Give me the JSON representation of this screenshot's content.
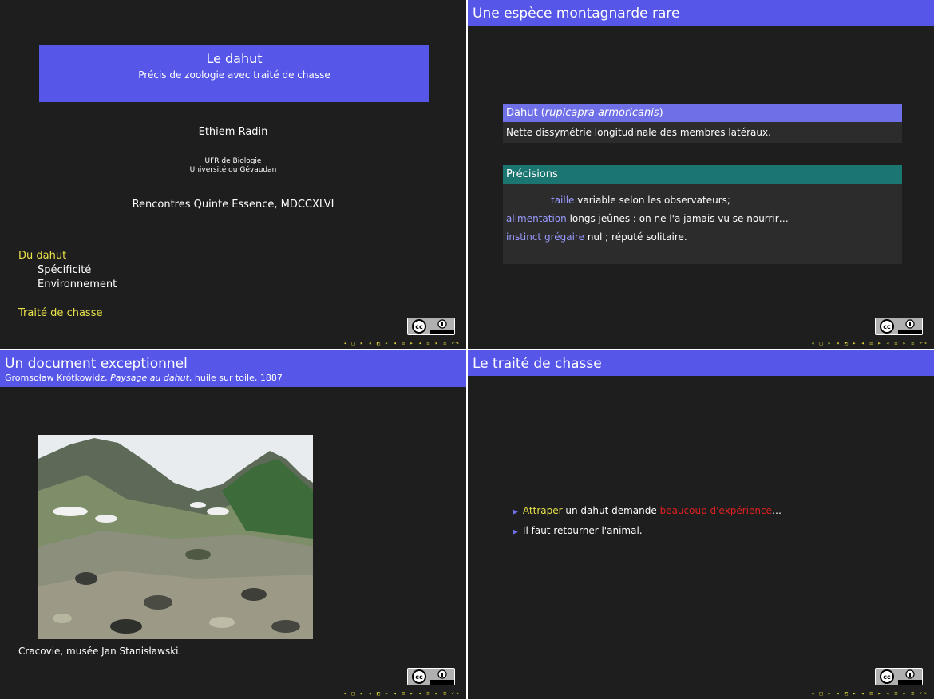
{
  "slide1": {
    "title": "Le dahut",
    "subtitle": "Précis de zoologie avec traité de chasse",
    "author": "Ethiem Radin",
    "institute_line1": "UFR de Biologie",
    "institute_line2": "Université du Gévaudan",
    "date": "Rencontres Quinte Essence, MDCCXLVI",
    "toc": [
      {
        "label": "Du dahut",
        "subs": [
          "Spécificité",
          "Environnement"
        ]
      },
      {
        "label": "Traité de chasse",
        "subs": []
      }
    ]
  },
  "slide2": {
    "title": "Une espèce montagnarde rare",
    "block1_title_prefix": "Dahut (",
    "block1_title_italic": "rupicapra armoricanis",
    "block1_title_suffix": ")",
    "block1_body": "Nette dissymétrie longitudinale des membres latéraux.",
    "block2_title": "Précisions",
    "definitions": [
      {
        "term": "taille",
        "desc": "variable selon les observateurs;"
      },
      {
        "term": "alimentation",
        "desc": "longs jeûnes : on ne l'a jamais vu se nourrir…"
      },
      {
        "term": "instinct grégaire",
        "desc": "nul ; réputé solitaire."
      }
    ]
  },
  "slide3": {
    "title": "Un document exceptionnel",
    "subtitle_prefix": "Gromsoław Krótkowidz, ",
    "subtitle_italic": "Paysage au dahut",
    "subtitle_suffix": ", huile sur toile, 1887",
    "caption": "Cracovie, musée Jan Stanisławski."
  },
  "slide4": {
    "title": "Le traité de chasse",
    "item1": {
      "yellow": "Attraper",
      "middle": " un dahut demande ",
      "red": "beaucoup d'expérience",
      "end": "…"
    },
    "item2": "Il faut retourner l'animal."
  },
  "common": {
    "nav_symbols": "◂ □ ▸ ◂ ◩ ▸ ◂ ≡ ▸ ◂ ≡ ▸   ≡   ↶↷",
    "license_badge_text": "cc BY"
  },
  "colors": {
    "background": "#1e1e1e",
    "accent": "#5656e9",
    "block_title": "#6f6fe7",
    "teal_block": "#1b7571",
    "alert": "#e02020",
    "highlight": "#e8e24a"
  }
}
